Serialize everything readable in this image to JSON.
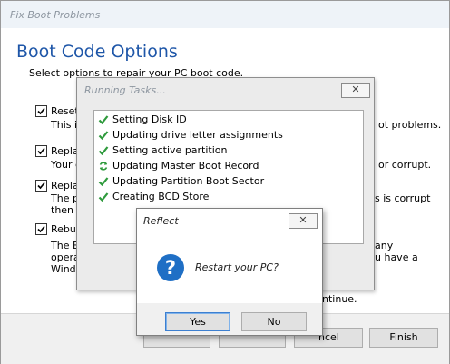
{
  "main_window": {
    "title": "Fix Boot Problems",
    "heading": "Boot Code Options",
    "subtitle": "Select options to repair your PC boot code.",
    "options": [
      {
        "label": "Reset",
        "desc": "This is",
        "desc_right": "ot problems.",
        "checked": true
      },
      {
        "label": "Replac",
        "desc": "Your c",
        "desc_right": "or corrupt.",
        "checked": true
      },
      {
        "label": "Replac",
        "desc": "The p",
        "desc2": "then y",
        "desc_right": "s is corrupt",
        "checked": true
      },
      {
        "label": "Rebuil",
        "desc": "The B",
        "desc2": "opera",
        "desc3": "Windo",
        "desc_right": "any",
        "desc_right2": "u have a",
        "checked": true
      }
    ],
    "partial_text": "ntinue.",
    "buttons": {
      "cancel_fragment": "ncel",
      "finish": "Finish"
    }
  },
  "tasks_dialog": {
    "title": "Running Tasks...",
    "close_glyph": "✕",
    "tasks": [
      {
        "label": "Setting Disk ID",
        "status": "done"
      },
      {
        "label": "Updating drive letter assignments",
        "status": "done"
      },
      {
        "label": "Setting active partition",
        "status": "done"
      },
      {
        "label": "Updating Master Boot Record",
        "status": "running"
      },
      {
        "label": "Updating Partition Boot Sector",
        "status": "done"
      },
      {
        "label": "Creating BCD Store",
        "status": "done"
      }
    ]
  },
  "reflect_dialog": {
    "title": "Reflect",
    "close_glyph": "✕",
    "icon": "question-icon",
    "icon_glyph": "?",
    "message": "Restart your PC?",
    "yes": "Yes",
    "no": "No"
  },
  "colors": {
    "heading": "#1e56a8",
    "check": "#2e9a3c",
    "question": "#1f6fc5"
  }
}
